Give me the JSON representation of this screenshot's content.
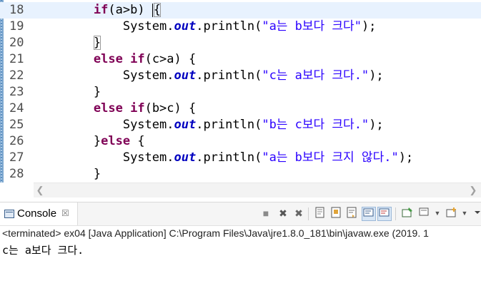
{
  "editor": {
    "lines": [
      {
        "num": "18"
      },
      {
        "num": "19"
      },
      {
        "num": "20"
      },
      {
        "num": "21"
      },
      {
        "num": "22"
      },
      {
        "num": "23"
      },
      {
        "num": "24"
      },
      {
        "num": "25"
      },
      {
        "num": "26"
      },
      {
        "num": "27"
      },
      {
        "num": "28"
      }
    ],
    "tokens": {
      "kw_if": "if",
      "kw_else": "else",
      "sys": "System.",
      "out": "out",
      "println_open": ".println(",
      "close_stmt": ");",
      "cond_18": "(a>b) ",
      "cond_21": "(c>a) {",
      "cond_24": "(b>c) {",
      "brace_open": "{",
      "brace_close": "}",
      "else_open": " {",
      "str_19": "\"a는 b보다 크다\"",
      "str_22": "\"c는 a보다 크다.\"",
      "str_25": "\"b는 c보다 크다.\"",
      "str_27": "\"a는 b보다 크지 않다.\""
    }
  },
  "console": {
    "tab_label": "Console",
    "tab_close": "☒",
    "status": "<terminated> ex04 [Java Application] C:\\Program Files\\Java\\jre1.8.0_181\\bin\\javaw.exe (2019. 1",
    "output": "c는 a보다 크다."
  },
  "icons": {
    "terminate": "■",
    "remove_launch": "✖",
    "remove_all": "✖",
    "scroll_lock": "▦",
    "word_wrap": "▤"
  }
}
